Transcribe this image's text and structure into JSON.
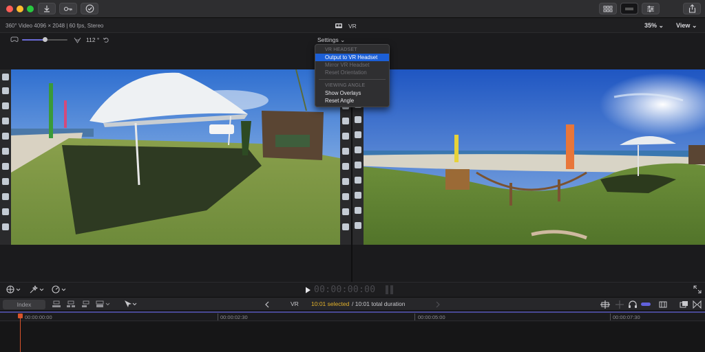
{
  "toolbar": {
    "traffic_colors": [
      "#ff5f57",
      "#febc2e",
      "#28c840"
    ],
    "left_buttons": [
      "import-icon",
      "keywords-icon",
      "background-tasks-icon"
    ],
    "right_buttons": [
      "browser-layout-icon",
      "timeline-layout-icon",
      "inspector-layout-icon",
      "share-icon"
    ]
  },
  "viewer": {
    "clip_info": "360° Video 4096 × 2048 | 60 fps, Stereo",
    "mode_label": "VR",
    "zoom": "35%",
    "view_menu": "View",
    "angle_value": "112 °",
    "settings_label": "Settings",
    "slider_level": 0.5
  },
  "settings_menu": {
    "header_vr": "VR HEADSET",
    "output_item": "Output to VR Headset",
    "mirror_item": "Mirror VR Headset",
    "reset_orientation_item": "Reset Orientation",
    "header_angle": "VIEWING ANGLE",
    "show_overlays_item": "Show Overlays",
    "reset_angle_item": "Reset Angle",
    "selected_color": "#1c5fd6"
  },
  "transport": {
    "timecode": "00:00:00:00"
  },
  "timeline_toolbar": {
    "index_label": "Index",
    "project_name": "VR",
    "selected_text": "10:01 selected",
    "total_text": " / 10:01 total duration",
    "selected_color": "#e3b22a"
  },
  "ruler": {
    "labels": [
      "00:00:00:00",
      "00:00:02:30",
      "00:00:05:00",
      "00:00:07:30"
    ]
  }
}
